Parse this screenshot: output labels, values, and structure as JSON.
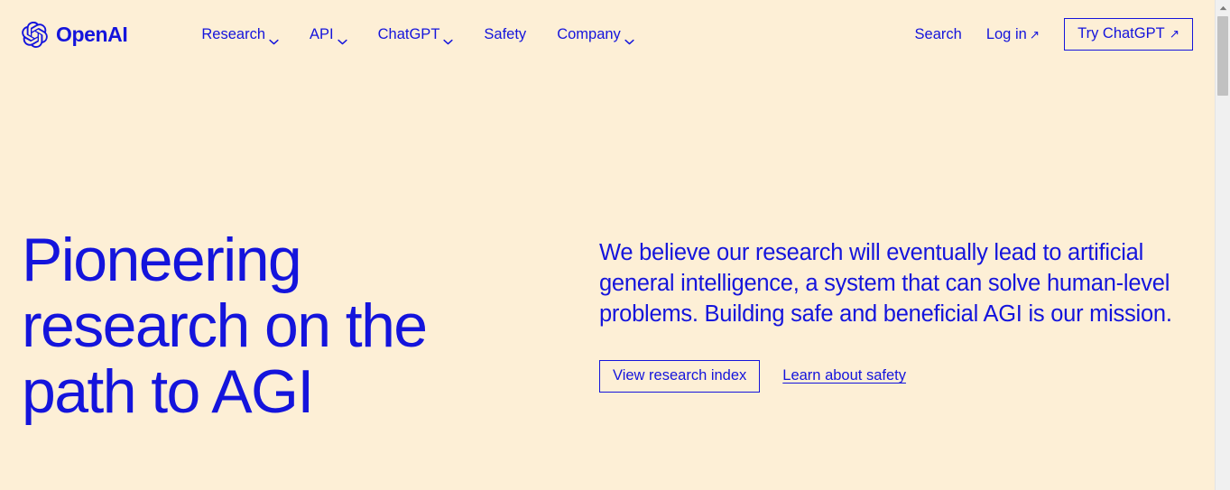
{
  "colors": {
    "background": "#fdefd6",
    "brand_blue": "#1414dc"
  },
  "header": {
    "brand": {
      "name": "OpenAI",
      "logo_icon": "openai-blossom-icon"
    },
    "nav": [
      {
        "label": "Research",
        "has_chevron": true
      },
      {
        "label": "API",
        "has_chevron": true
      },
      {
        "label": "ChatGPT",
        "has_chevron": true
      },
      {
        "label": "Safety",
        "has_chevron": false
      },
      {
        "label": "Company",
        "has_chevron": true
      }
    ],
    "search_label": "Search",
    "login_label": "Log in",
    "login_arrow": "↗",
    "cta_label": "Try ChatGPT",
    "cta_arrow": "↗"
  },
  "hero": {
    "title": "Pioneering\nresearch on the\npath to AGI",
    "lede": "We believe our research will eventually lead to artificial general intelligence, a system that can solve human-level problems. Building safe and beneficial AGI is our mission.",
    "primary_action": "View research index",
    "secondary_action": "Learn about safety"
  },
  "scrollbar": {
    "up_arrow_icon": "scroll-up-arrow-icon",
    "position": "top"
  }
}
